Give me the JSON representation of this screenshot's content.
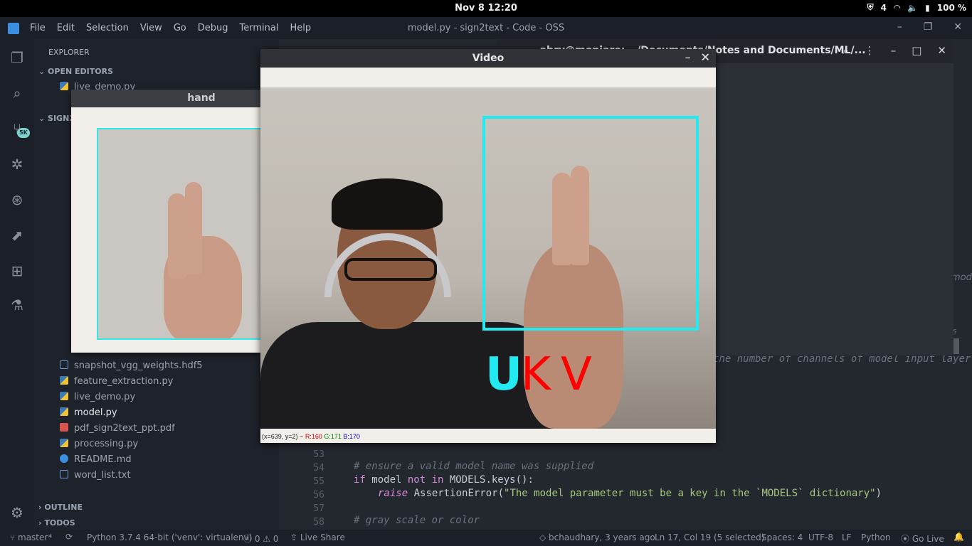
{
  "topbar": {
    "clock": "Nov 8  12:20",
    "notifications": "4",
    "battery": "100 %"
  },
  "menubar": {
    "menus": [
      "File",
      "Edit",
      "Selection",
      "View",
      "Go",
      "Debug",
      "Terminal",
      "Help"
    ],
    "title": "model.py - sign2text - Code - OSS"
  },
  "activity": {
    "icons": [
      "explorer-icon",
      "search-icon",
      "source-control-icon",
      "debug-icon",
      "git-graph-icon",
      "remote-icon",
      "extensions-icon",
      "test-icon",
      "settings-icon"
    ],
    "scm_badge": "5K"
  },
  "sidebar": {
    "header": "EXPLORER",
    "open_editors": "OPEN EDITORS",
    "open_files": [
      "live_demo.py"
    ],
    "project": "SIGN2",
    "files": [
      {
        "name": "snapshot_vgg_weights.hdf5",
        "kind": "hdf"
      },
      {
        "name": "feature_extraction.py",
        "kind": "py"
      },
      {
        "name": "live_demo.py",
        "kind": "py"
      },
      {
        "name": "model.py",
        "kind": "py"
      },
      {
        "name": "pdf_sign2text_ppt.pdf",
        "kind": "pdf"
      },
      {
        "name": "processing.py",
        "kind": "py"
      },
      {
        "name": "README.md",
        "kind": "md"
      },
      {
        "name": "word_list.txt",
        "kind": "txt"
      }
    ],
    "outline": "OUTLINE",
    "todos": "TODOS"
  },
  "editor": {
    "lines": [
      {
        "num": "53",
        "html": ""
      },
      {
        "num": "54",
        "comment": "# ensure a valid model name was supplied"
      },
      {
        "num": "55",
        "kw": "if",
        "rest1": " model ",
        "kw2": "not in",
        "rest2": " MODELS.keys():"
      },
      {
        "num": "56",
        "kwi": "raise",
        "rest": " AssertionError(",
        "str": "\"The model parameter must be a key in the `MODELS` dictionary\"",
        "end": ")"
      },
      {
        "num": "57"
      },
      {
        "num": "58",
        "comment": "# gray scale or color"
      }
    ],
    "fragment_right": "the number of channels of model input layer",
    "fragment_mode": "mode",
    "fragment_es": "es"
  },
  "terminal": {
    "title": "~ abrv@moniare: ~/Documents/Notes and Documents/ML/..."
  },
  "hand_window": {
    "title": "hand"
  },
  "video_window": {
    "title": "Video",
    "prediction": {
      "u": "U",
      "rest": "KV"
    },
    "status_coords": "(x=639, y=2) ~",
    "status_r": "R:160",
    "status_g": "G:171",
    "status_b": "B:170"
  },
  "statusbar": {
    "branch": "master*",
    "python": "Python 3.7.4 64-bit ('venv': virtualenv)",
    "problems": "0",
    "warnings": "0",
    "liveshare": "Live Share",
    "blame": "bchaudhary, 3 years ago",
    "position": "Ln 17, Col 19 (5 selected)",
    "spaces": "Spaces: 4",
    "encoding": "UTF-8",
    "eol": "LF",
    "language": "Python",
    "golive": "Go Live"
  },
  "colors": {
    "accent_cyan": "#22eaf0",
    "prediction_red": "#ff0000"
  }
}
